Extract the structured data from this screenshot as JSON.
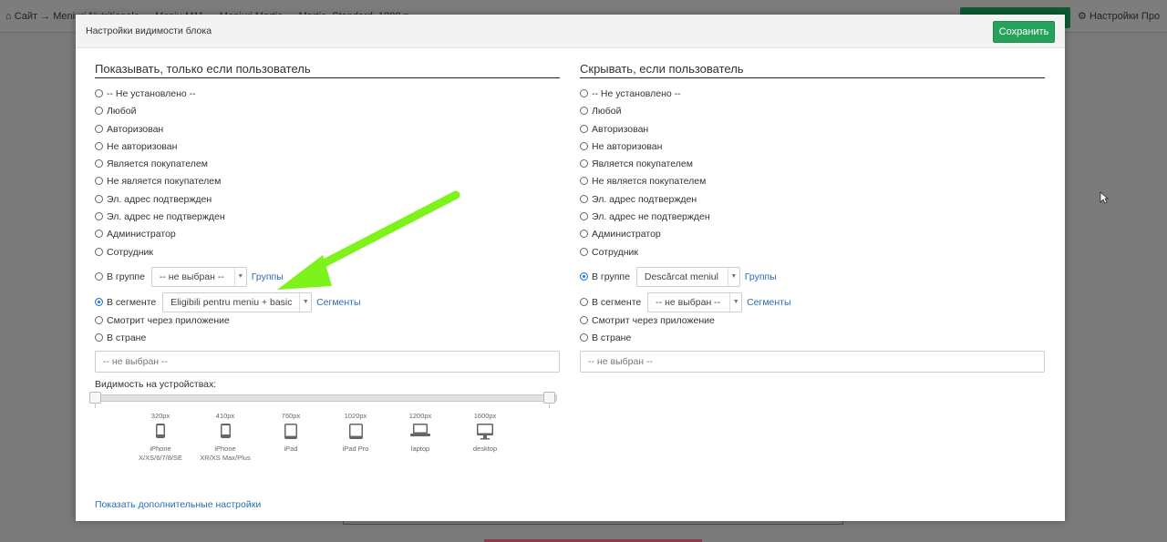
{
  "background": {
    "breadcrumb": "Сайт → Meniuri Nutritionale → Meniu M11 → Meniuri Martie → Martie_Standard_1800 ▾",
    "right_text": "Настройки    Про"
  },
  "modal": {
    "title": "Настройки видимости блока",
    "save_label": "Сохранить",
    "show_col": {
      "title": "Показывать, только если пользователь",
      "options": [
        "-- Не установлено --",
        "Любой",
        "Авторизован",
        "Не авторизован",
        "Является покупателем",
        "Не является покупателем",
        "Эл. адрес подтвержден",
        "Эл. адрес не подтвержден",
        "Администратор",
        "Сотрудник"
      ],
      "group_label": "В группе",
      "group_value": "-- не выбран --",
      "group_link": "Группы",
      "segment_label": "В сегменте",
      "segment_value": "Eligibili pentru meniu + basic",
      "segment_link": "Сегменты",
      "app_label": "Смотрит через приложение",
      "country_label": "В стране",
      "country_placeholder": "-- не выбран --",
      "selected": "segment"
    },
    "hide_col": {
      "title": "Скрывать, если пользователь",
      "options": [
        "-- Не установлено --",
        "Любой",
        "Авторизован",
        "Не авторизован",
        "Является покупателем",
        "Не является покупателем",
        "Эл. адрес подтвержден",
        "Эл. адрес не подтвержден",
        "Администратор",
        "Сотрудник"
      ],
      "group_label": "В группе",
      "group_value": "Descărcat meniul",
      "group_link": "Группы",
      "segment_label": "В сегменте",
      "segment_value": "-- не выбран --",
      "segment_link": "Сегменты",
      "app_label": "Смотрит через приложение",
      "country_label": "В стране",
      "country_placeholder": "-- не выбран --",
      "selected": "group"
    },
    "devices_label": "Видимость на устройствах:",
    "devices": [
      {
        "px": "320px",
        "name1": "iPhone",
        "name2": "X/XS/6/7/8/SE",
        "icon": "phone-icon"
      },
      {
        "px": "410px",
        "name1": "iPhone",
        "name2": "XR/XS Max/Plus",
        "icon": "phone-large-icon"
      },
      {
        "px": "760px",
        "name1": "iPad",
        "name2": "",
        "icon": "tablet-icon"
      },
      {
        "px": "1020px",
        "name1": "iPad Pro",
        "name2": "",
        "icon": "tablet-large-icon"
      },
      {
        "px": "1200px",
        "name1": "laptop",
        "name2": "",
        "icon": "laptop-icon"
      },
      {
        "px": "1600px",
        "name1": "desktop",
        "name2": "",
        "icon": "desktop-icon"
      }
    ],
    "more_settings": "Показать дополнительные настройки",
    "accent_color": "#27a25b",
    "annotation_arrow_color": "#7ef21b"
  }
}
